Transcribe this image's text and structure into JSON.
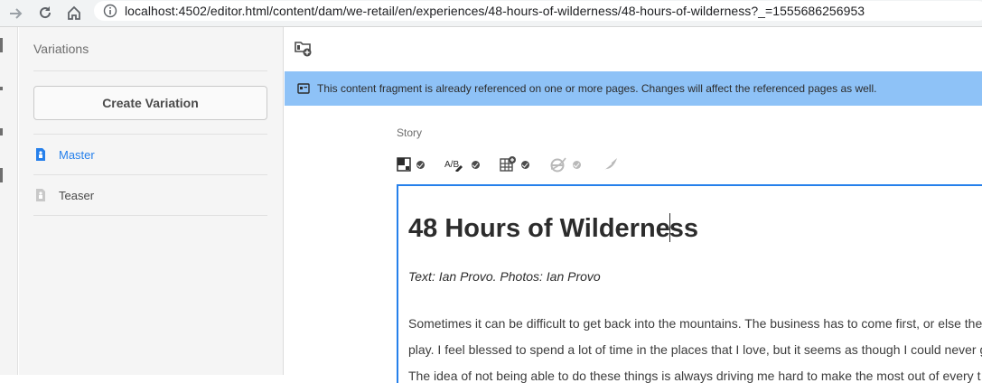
{
  "browser": {
    "url": "localhost:4502/editor.html/content/dam/we-retail/en/experiences/48-hours-of-wilderness/48-hours-of-wilderness?_=1555686256953"
  },
  "variations": {
    "title": "Variations",
    "create_label": "Create Variation",
    "items": [
      {
        "label": "Master",
        "color": "#2680eb",
        "active": true
      },
      {
        "label": "Teaser",
        "color": "#4b4b4b",
        "active": false
      }
    ]
  },
  "alert": {
    "text": "This content fragment is already referenced on one or more pages. Changes will affect the referenced pages as well.",
    "background": "#8ec2f7"
  },
  "editor": {
    "field_label": "Story",
    "title": "48 Hours of Wilderness",
    "title_before_caret": "48 Hours of Wilderne",
    "title_after_caret": "ss",
    "byline": "Text: Ian Provo. Photos: Ian Provo",
    "paragraph_lines": [
      "Sometimes it can be difficult to get back into the mountains. The business has to come first, or else the",
      "play. I feel blessed to spend a lot of time in the places that I love, but it seems as though I could never g",
      "The idea of not being able to do these things is always driving me hard to make the most out of every t"
    ],
    "accent_color": "#2680eb"
  },
  "icons": {
    "back": "arrow-right-icon",
    "reload": "reload-icon",
    "home": "home-icon",
    "info": "info-icon",
    "folder_add": "folder-add-icon",
    "alert": "alert-info-icon",
    "tools": [
      "format-table-icon",
      "spellcheck-icon",
      "table-insert-icon",
      "link-icon",
      "feather-icon"
    ]
  }
}
